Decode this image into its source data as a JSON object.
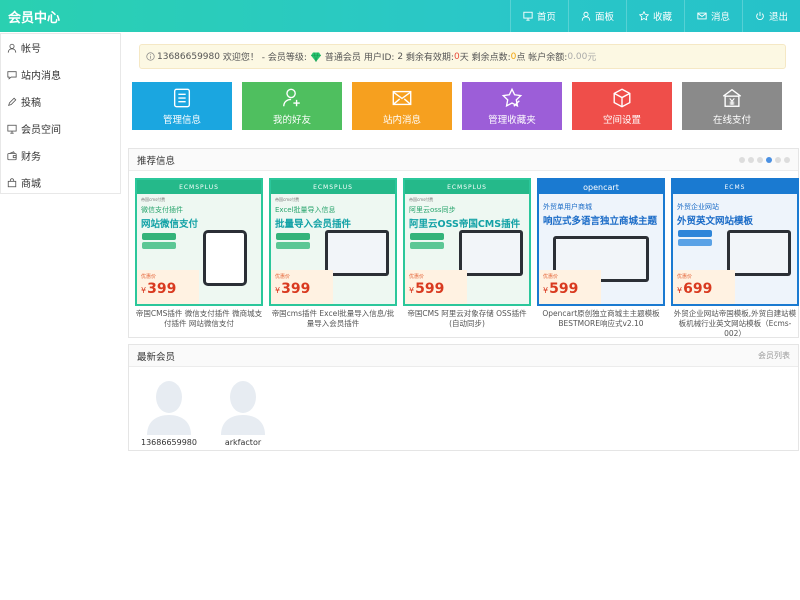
{
  "header": {
    "title": "会员中心",
    "nav": [
      {
        "label": "首页",
        "icon": "monitor-icon"
      },
      {
        "label": "面板",
        "icon": "user-icon"
      },
      {
        "label": "收藏",
        "icon": "star-icon"
      },
      {
        "label": "消息",
        "icon": "envelope-icon"
      },
      {
        "label": "退出",
        "icon": "power-icon"
      }
    ]
  },
  "sidebar": {
    "items": [
      {
        "label": "帐号",
        "icon": "user-icon"
      },
      {
        "label": "站内消息",
        "icon": "chat-icon"
      },
      {
        "label": "投稿",
        "icon": "pencil-icon"
      },
      {
        "label": "会员空间",
        "icon": "monitor-icon"
      },
      {
        "label": "财务",
        "icon": "wallet-icon"
      },
      {
        "label": "商城",
        "icon": "cart-icon"
      }
    ]
  },
  "notice": {
    "username": "13686659980",
    "welcome": "欢迎您！",
    "level_label": "- 会员等级:",
    "level": "普通会员",
    "uid_label": "用户ID:",
    "uid": "2",
    "valid_label": "剩余有效期:",
    "valid_days": "0",
    "days_unit": "天",
    "points_label": "剩余点数:",
    "points": "0",
    "points_unit": "点",
    "balance_label": "帐户余额:",
    "balance": "0.00",
    "balance_unit": "元"
  },
  "tiles": [
    {
      "label": "管理信息",
      "color": "#1ba6e0",
      "icon": "list-icon"
    },
    {
      "label": "我的好友",
      "color": "#4fbf5f",
      "icon": "add-user-icon"
    },
    {
      "label": "站内消息",
      "color": "#f6a01f",
      "icon": "envelope-icon"
    },
    {
      "label": "管理收藏夹",
      "color": "#9c5ed8",
      "icon": "star-icon"
    },
    {
      "label": "空间设置",
      "color": "#ef4e4a",
      "icon": "cube-icon"
    },
    {
      "label": "在线支付",
      "color": "#8a8a8a",
      "icon": "payment-icon"
    }
  ],
  "recommend": {
    "title": "推荐信息",
    "active_dot": 3,
    "dot_count": 6,
    "items": [
      {
        "brand": "ECMSPLUS",
        "sub": "帝国cms付费",
        "line1": "微信支付插件",
        "line2": "网站微信支付",
        "tag1": "安装指导",
        "tag2": "免费升级",
        "price_label": "优惠价",
        "currency": "¥",
        "price": "399",
        "device": "phone",
        "theme": "green",
        "caption": "帝国CMS插件 微信支付插件 微商城支付插件 网站微信支付"
      },
      {
        "brand": "ECMSPLUS",
        "sub": "帝国cms付费",
        "line1": "Excel批量导入信息",
        "line2": "批量导入会员插件",
        "tag1": "安装指导",
        "tag2": "免费升级",
        "price_label": "优惠价",
        "currency": "¥",
        "price": "399",
        "device": "laptop",
        "theme": "green",
        "caption": "帝国cms插件 Excel批量导入信息/批量导入会员插件"
      },
      {
        "brand": "ECMSPLUS",
        "sub": "帝国cms付费",
        "line1": "阿里云oss同步",
        "line2": "阿里云OSS帝国CMS插件",
        "tag1": "安装指导",
        "tag2": "免费升级",
        "price_label": "优惠价",
        "currency": "¥",
        "price": "599",
        "device": "laptop",
        "theme": "green",
        "caption": "帝国CMS 阿里云对象存储 OSS插件 (自动同步)"
      },
      {
        "brand": "opencart",
        "sub": "",
        "line1": "外贸单用户商城",
        "line2": "响应式多语言独立商城主题",
        "tag1": "",
        "tag2": "",
        "price_label": "优惠价",
        "currency": "¥",
        "price": "599",
        "device": "laptop",
        "theme": "blue",
        "caption": "Opencart原创独立商城主主题模板BESTMORE响应式v2.10"
      },
      {
        "brand": "ECMS",
        "sub": "",
        "line1": "外贸企业网站",
        "line2": "外贸英文网站模板",
        "tag1": "安装指导",
        "tag2": "免费升级",
        "price_label": "优惠价",
        "currency": "¥",
        "price": "699",
        "device": "laptop",
        "theme": "blue",
        "caption": "外贸企业网站帝国模板,外贸自建站模板机械行业英文网站模板（Ecms-002）"
      }
    ]
  },
  "latest": {
    "title": "最新会员",
    "more": "会员列表",
    "members": [
      {
        "name": "13686659980"
      },
      {
        "name": "arkfactor"
      }
    ]
  },
  "colors": {
    "header_start": "#2ad0b1",
    "header_end": "#26c2c9",
    "active_dot": "#4a90e2"
  }
}
